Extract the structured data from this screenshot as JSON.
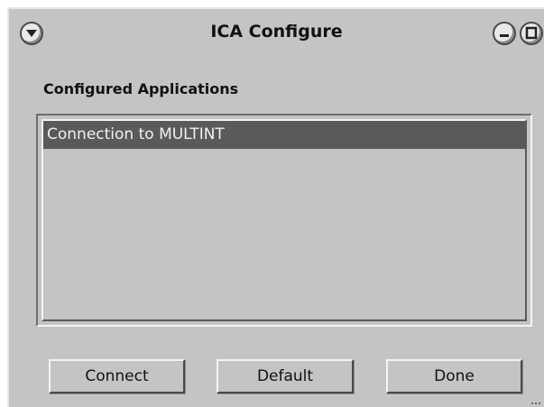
{
  "window": {
    "title": "ICA Configure",
    "controls": {
      "menu_icon": "triangle-down-icon",
      "minimize_icon": "minimize-icon",
      "maximize_icon": "maximize-icon"
    }
  },
  "section": {
    "label": "Configured Applications"
  },
  "applications": {
    "items": [
      {
        "label": "Connection to MULTINT",
        "selected": true
      }
    ]
  },
  "buttons": {
    "connect": "Connect",
    "default": "Default",
    "done": "Done"
  },
  "colors": {
    "window_bg": "#c4c4c4",
    "selection_bg": "#5a5a5a",
    "selection_text": "#f0f0f0"
  }
}
